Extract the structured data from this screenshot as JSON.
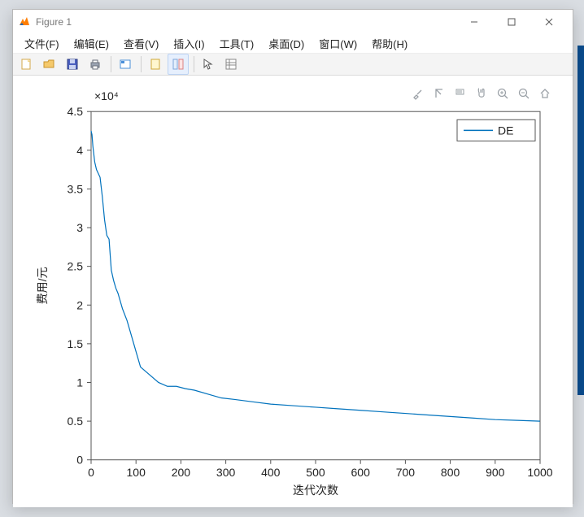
{
  "window": {
    "title": "Figure 1"
  },
  "menubar": {
    "items": [
      {
        "label": "文件(F)"
      },
      {
        "label": "编辑(E)"
      },
      {
        "label": "查看(V)"
      },
      {
        "label": "插入(I)"
      },
      {
        "label": "工具(T)"
      },
      {
        "label": "桌面(D)"
      },
      {
        "label": "窗口(W)"
      },
      {
        "label": "帮助(H)"
      }
    ]
  },
  "toolbar": {
    "buttons": {
      "new": "new-figure-icon",
      "open": "open-file-icon",
      "save": "save-icon",
      "print": "print-icon",
      "data_cursor_group": "data-cursor-icon",
      "link": "link-axes-icon",
      "colorbar": "colorbar-icon",
      "legend": "legend-icon",
      "arrow": "edit-plot-icon",
      "inspect": "inspector-icon"
    }
  },
  "figure_tools": {
    "labels": {
      "brush": "brush-icon",
      "datatip": "rotate-icon",
      "pan": "pan-icon",
      "hand": "hand-icon",
      "zoom_in": "zoom-in-icon",
      "zoom_out": "zoom-out-icon",
      "home": "home-icon"
    }
  },
  "chart_data": {
    "type": "line",
    "exponent_label": "×10⁴",
    "x": [
      0,
      2,
      4,
      8,
      12,
      16,
      20,
      25,
      30,
      35,
      40,
      45,
      50,
      55,
      60,
      70,
      80,
      90,
      100,
      110,
      120,
      130,
      150,
      170,
      190,
      210,
      230,
      260,
      290,
      320,
      360,
      400,
      450,
      500,
      550,
      600,
      650,
      700,
      750,
      800,
      850,
      900,
      950,
      1000
    ],
    "y": [
      4.25,
      4.2,
      4.05,
      3.85,
      3.75,
      3.7,
      3.65,
      3.4,
      3.1,
      2.9,
      2.85,
      2.45,
      2.32,
      2.22,
      2.15,
      1.95,
      1.8,
      1.6,
      1.4,
      1.2,
      1.15,
      1.1,
      1.0,
      0.95,
      0.95,
      0.92,
      0.9,
      0.85,
      0.8,
      0.78,
      0.75,
      0.72,
      0.7,
      0.68,
      0.66,
      0.64,
      0.62,
      0.6,
      0.58,
      0.56,
      0.54,
      0.52,
      0.51,
      0.5
    ],
    "series": [
      {
        "name": "DE"
      }
    ],
    "xlabel": "迭代次数",
    "ylabel": "费用/元",
    "xlim": [
      0,
      1000
    ],
    "ylim": [
      0,
      4.5
    ],
    "xticks": [
      0,
      100,
      200,
      300,
      400,
      500,
      600,
      700,
      800,
      900,
      1000
    ],
    "yticks": [
      0,
      0.5,
      1,
      1.5,
      2,
      2.5,
      3,
      3.5,
      4,
      4.5
    ],
    "line_color": "#0072BD",
    "legend": {
      "label": "DE",
      "position": "northeast"
    }
  }
}
